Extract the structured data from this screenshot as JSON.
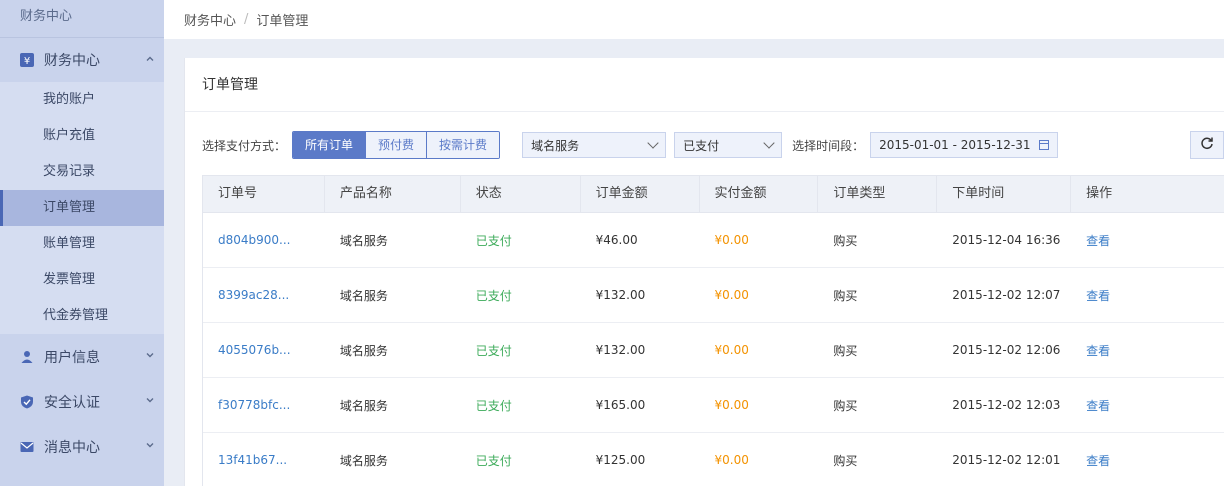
{
  "sidebar": {
    "top_title": "财务中心",
    "finance_group": {
      "label": "财务中心",
      "icon": "yen-icon"
    },
    "finance_items": [
      {
        "label": "我的账户"
      },
      {
        "label": "账户充值"
      },
      {
        "label": "交易记录"
      },
      {
        "label": "订单管理",
        "active": true
      },
      {
        "label": "账单管理"
      },
      {
        "label": "发票管理"
      },
      {
        "label": "代金券管理"
      }
    ],
    "user_group": {
      "label": "用户信息",
      "icon": "user-icon"
    },
    "security_group": {
      "label": "安全认证",
      "icon": "shield-icon"
    },
    "message_group": {
      "label": "消息中心",
      "icon": "mail-icon"
    }
  },
  "breadcrumb": {
    "root": "财务中心",
    "separator": "/",
    "current": "订单管理"
  },
  "card": {
    "title": "订单管理"
  },
  "filters": {
    "pay_label": "选择支付方式：",
    "pay_options": [
      "所有订单",
      "预付费",
      "按需计费"
    ],
    "pay_selected": "所有订单",
    "product_select": "域名服务",
    "status_select": "已支付",
    "time_label": "选择时间段：",
    "date_range": "2015-01-01 - 2015-12-31"
  },
  "table": {
    "headers": [
      "订单号",
      "产品名称",
      "状态",
      "订单金额",
      "实付金额",
      "订单类型",
      "下单时间",
      "操作"
    ],
    "rows": [
      {
        "id": "d804b900...",
        "product": "域名服务",
        "status": "已支付",
        "amount": "¥46.00",
        "paid": "¥0.00",
        "type": "购买",
        "time": "2015-12-04 16:36",
        "action": "查看"
      },
      {
        "id": "8399ac28...",
        "product": "域名服务",
        "status": "已支付",
        "amount": "¥132.00",
        "paid": "¥0.00",
        "type": "购买",
        "time": "2015-12-02 12:07",
        "action": "查看"
      },
      {
        "id": "4055076b...",
        "product": "域名服务",
        "status": "已支付",
        "amount": "¥132.00",
        "paid": "¥0.00",
        "type": "购买",
        "time": "2015-12-02 12:06",
        "action": "查看"
      },
      {
        "id": "f30778bfc...",
        "product": "域名服务",
        "status": "已支付",
        "amount": "¥165.00",
        "paid": "¥0.00",
        "type": "购买",
        "time": "2015-12-02 12:03",
        "action": "查看"
      },
      {
        "id": "13f41b67...",
        "product": "域名服务",
        "status": "已支付",
        "amount": "¥125.00",
        "paid": "¥0.00",
        "type": "购买",
        "time": "2015-12-02 12:01",
        "action": "查看"
      }
    ]
  },
  "colors": {
    "accent": "#5b7ac8",
    "paid_green": "#3cab5a",
    "amount_orange": "#f39200",
    "link_blue": "#3a7cc7",
    "sidebar_bg": "#c9d3ec"
  }
}
